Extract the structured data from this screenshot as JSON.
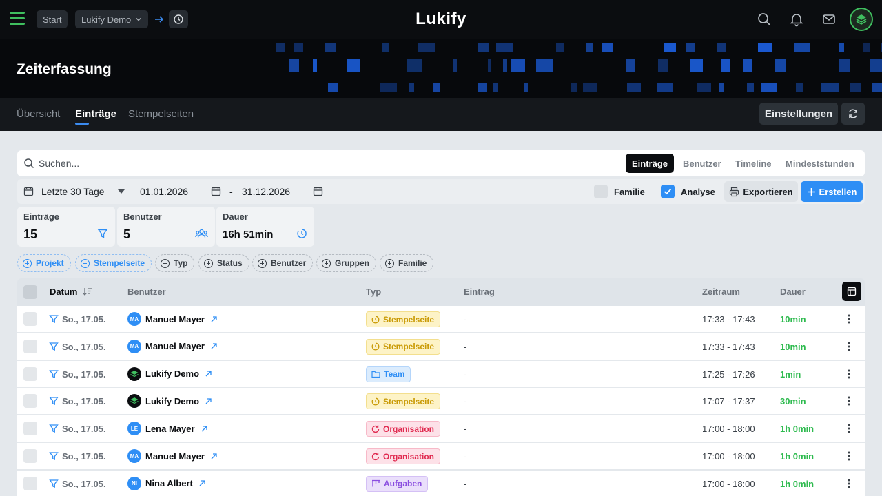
{
  "header": {
    "brand": "Lukify",
    "breadcrumb": {
      "start": "Start",
      "org": "Lukify Demo"
    }
  },
  "page": {
    "title": "Zeiterfassung"
  },
  "tabs": [
    {
      "label": "Übersicht"
    },
    {
      "label": "Einträge"
    },
    {
      "label": "Stempelseiten"
    }
  ],
  "toolbar": {
    "settings_label": "Einstellungen"
  },
  "search": {
    "placeholder": "Suchen...",
    "value": ""
  },
  "view_tabs": [
    {
      "label": "Einträge"
    },
    {
      "label": "Benutzer"
    },
    {
      "label": "Timeline"
    },
    {
      "label": "Mindeststunden"
    }
  ],
  "filters": {
    "range_label": "Letzte 30 Tage",
    "date_from": "01.01.2026",
    "separator": "-",
    "date_to": "31.12.2026",
    "family_label": "Familie",
    "family_checked": false,
    "analysis_label": "Analyse",
    "analysis_checked": true,
    "export_label": "Exportieren",
    "create_label": "Erstellen"
  },
  "stats": [
    {
      "label": "Einträge",
      "value": "15",
      "icon": "filter-icon"
    },
    {
      "label": "Benutzer",
      "value": "5",
      "icon": "users-icon"
    },
    {
      "label": "Dauer",
      "value": "16h 51min",
      "icon": "timer-icon"
    }
  ],
  "chips": [
    {
      "label": "Projekt"
    },
    {
      "label": "Stempelseite"
    },
    {
      "label": "Typ"
    },
    {
      "label": "Status"
    },
    {
      "label": "Benutzer"
    },
    {
      "label": "Gruppen"
    },
    {
      "label": "Familie"
    }
  ],
  "table": {
    "columns": [
      "Datum",
      "Benutzer",
      "Typ",
      "Eintrag",
      "Zeitraum",
      "Dauer"
    ],
    "rows": [
      {
        "date": "So., 17.05.",
        "user": "Manuel Mayer",
        "initials": "MA",
        "type": "Stempelseite",
        "entry": "-",
        "time": "17:33 - 17:43",
        "duration": "10min"
      },
      {
        "date": "So., 17.05.",
        "user": "Manuel Mayer",
        "initials": "MA",
        "type": "Stempelseite",
        "entry": "-",
        "time": "17:33 - 17:43",
        "duration": "10min"
      },
      {
        "date": "So., 17.05.",
        "user": "Lukify Demo",
        "initials": "",
        "type": "Team",
        "entry": "-",
        "time": "17:25 - 17:26",
        "duration": "1min"
      },
      {
        "date": "So., 17.05.",
        "user": "Lukify Demo",
        "initials": "",
        "type": "Stempelseite",
        "entry": "-",
        "time": "17:07 - 17:37",
        "duration": "30min"
      },
      {
        "date": "So., 17.05.",
        "user": "Lena Mayer",
        "initials": "LE",
        "type": "Organisation",
        "entry": "-",
        "time": "17:00 - 18:00",
        "duration": "1h 0min"
      },
      {
        "date": "So., 17.05.",
        "user": "Manuel Mayer",
        "initials": "MA",
        "type": "Organisation",
        "entry": "-",
        "time": "17:00 - 18:00",
        "duration": "1h 0min"
      },
      {
        "date": "So., 17.05.",
        "user": "Nina Albert",
        "initials": "NI",
        "type": "Aufgaben",
        "entry": "-",
        "time": "17:00 - 18:00",
        "duration": "1h 0min"
      }
    ]
  },
  "colors": {
    "accent": "#2e8ef5",
    "brand_green": "#3fbf5f",
    "duration_green": "#2dba4e",
    "stempelseite_bg": "#fdf3c7",
    "team_bg": "#dbecfd",
    "organisation_bg": "#fde1e8",
    "aufgaben_bg": "#eadffb"
  }
}
